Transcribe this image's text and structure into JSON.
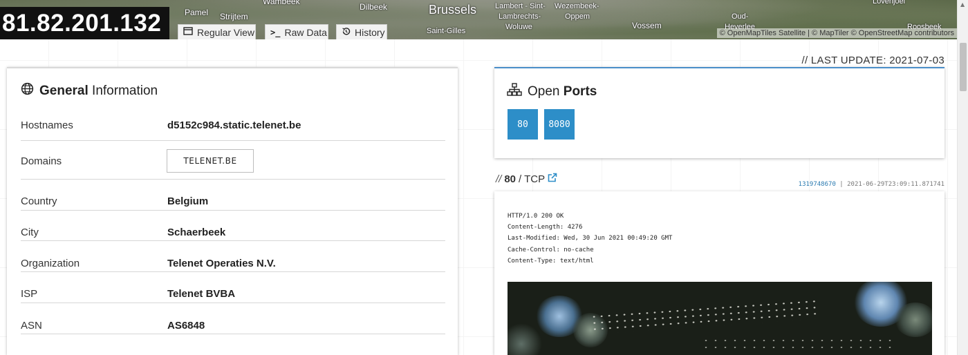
{
  "ip": "81.82.201.132",
  "map": {
    "labels": [
      "Pamel",
      "Strijtem",
      "Wambeek",
      "Dilbeek",
      "Brussels",
      "Lambert - Sint-",
      "Lambrechts-",
      "Woluwe",
      "Wezembeek-",
      "Oppem",
      "Saint-Gilles",
      "Vossem",
      "Oud-",
      "Heverlee",
      "Lovenjoel",
      "Roosbeek"
    ],
    "attribution": "© OpenMapTiles Satellite | © MapTiler © OpenStreetMap contributors"
  },
  "tabs": {
    "regular_view": "Regular View",
    "raw_data": "Raw Data",
    "history": "History"
  },
  "last_update": "// LAST UPDATE: 2021-07-03",
  "general": {
    "title_bold": "General",
    "title_rest": " Information",
    "rows": [
      {
        "key": "Hostnames",
        "value": "d5152c984.static.telenet.be"
      },
      {
        "key": "Domains",
        "value": "TELENET.BE"
      },
      {
        "key": "Country",
        "value": "Belgium"
      },
      {
        "key": "City",
        "value": "Schaerbeek"
      },
      {
        "key": "Organization",
        "value": "Telenet Operaties N.V."
      },
      {
        "key": "ISP",
        "value": "Telenet BVBA"
      },
      {
        "key": "ASN",
        "value": "AS6848"
      }
    ]
  },
  "ports": {
    "title_rest": "Open ",
    "title_bold": "Ports",
    "list": [
      "80",
      "8080"
    ]
  },
  "service": {
    "slash": "//",
    "port": "80",
    "protocol": "/ TCP",
    "hash": "1319748670",
    "timestamp": "| 2021-06-29T23:09:11.871741",
    "banner": "HTTP/1.0 200 OK\nContent-Length: 4276\nLast-Modified: Wed, 30 Jun 2021 00:49:20 GMT\nCache-Control: no-cache\nContent-Type: text/html"
  }
}
